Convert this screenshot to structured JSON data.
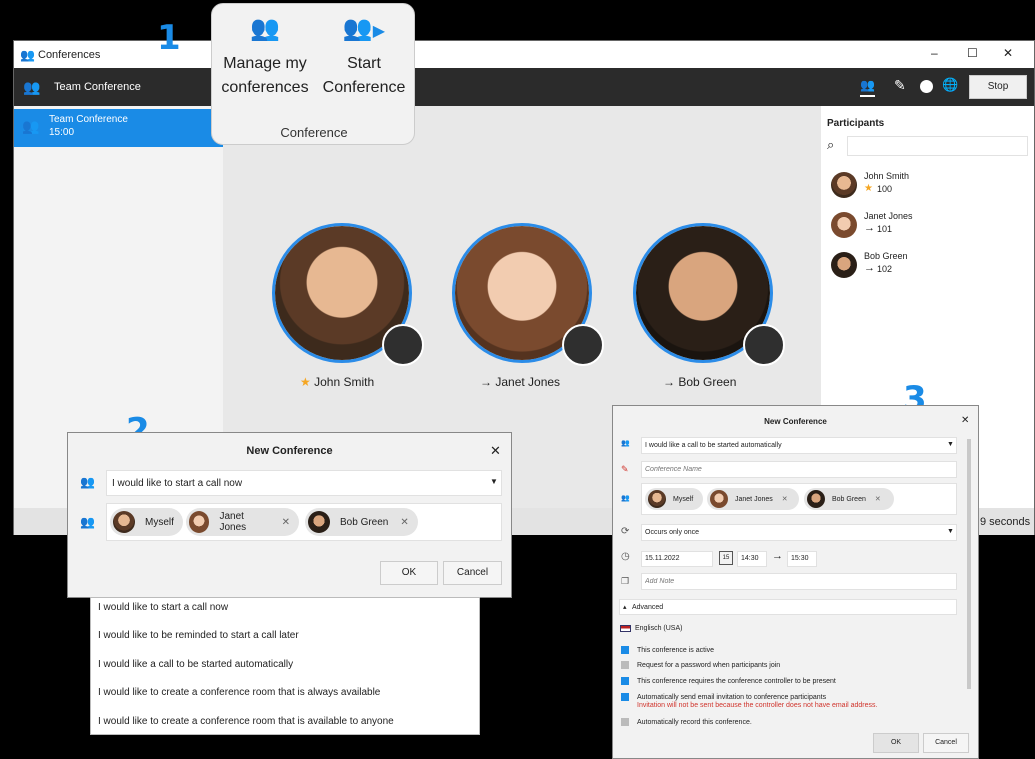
{
  "window": {
    "title": "Conferences",
    "controls": [
      "–",
      "☐",
      "✕"
    ]
  },
  "toolbar": {
    "conference_name": "Team Conference",
    "stop_label": "Stop"
  },
  "sidebar": {
    "item": {
      "title": "Team Conference",
      "time": "15:00"
    }
  },
  "popup": {
    "manage_label": "Manage my conferences",
    "start_label": "Start Conference",
    "group_label": "Conference"
  },
  "stage": {
    "people": [
      {
        "name": "John Smith",
        "marker": "★",
        "marker_color": "#f5a623"
      },
      {
        "name": "Janet Jones",
        "marker": "→",
        "marker_color": "#333333"
      },
      {
        "name": "Bob Green",
        "marker": "→",
        "marker_color": "#333333"
      }
    ]
  },
  "participants": {
    "title": "Participants",
    "search_placeholder": "",
    "list": [
      {
        "name": "John Smith",
        "ext": "100",
        "marker": "★"
      },
      {
        "name": "Janet Jones",
        "ext": "101",
        "marker": "→"
      },
      {
        "name": "Bob Green",
        "ext": "102",
        "marker": "→"
      }
    ]
  },
  "status": {
    "text": "9 seconds"
  },
  "callouts": [
    "1",
    "2",
    "3"
  ],
  "dialog1": {
    "title": "New Conference",
    "close": "✕",
    "selected_option": "I would like to start a call now",
    "chips": [
      "Myself",
      "Janet Jones",
      "Bob Green"
    ],
    "ok": "OK",
    "cancel": "Cancel"
  },
  "dropdown": {
    "options": [
      "I would like to start a call now",
      "I would like to be reminded to start a call later",
      "I would like a call to be started automatically",
      "I would like to create a conference room that is always available",
      "I would like to create a conference room that is available to anyone"
    ]
  },
  "dialog3": {
    "title": "New Conference",
    "close": "✕",
    "selected_option": "I would like a call to be started automatically",
    "name_placeholder": "Conference Name",
    "chips": [
      "Myself",
      "Janet Jones",
      "Bob Green"
    ],
    "recurrence": "Occurs only once",
    "date": "15.11.2022",
    "cal": "15",
    "start": "14:30",
    "end": "15:30",
    "note_placeholder": "Add Note",
    "advanced": "Advanced",
    "language": "Englisch (USA)",
    "options": [
      {
        "label": "This conference is active",
        "checked": true
      },
      {
        "label": "Request for a password when participants join",
        "checked": false
      },
      {
        "label": "This conference requires the conference controller to be present",
        "checked": true
      },
      {
        "label": "Automatically send email invitation to conference participants",
        "checked": true
      },
      {
        "label": "Automatically record this conference.",
        "checked": false
      }
    ],
    "warning": "Invitation will not be sent because the controller does not have email address.",
    "ok": "OK",
    "cancel": "Cancel"
  },
  "colors": {
    "accent": "#1a8be6",
    "warning": "#d0342c"
  }
}
